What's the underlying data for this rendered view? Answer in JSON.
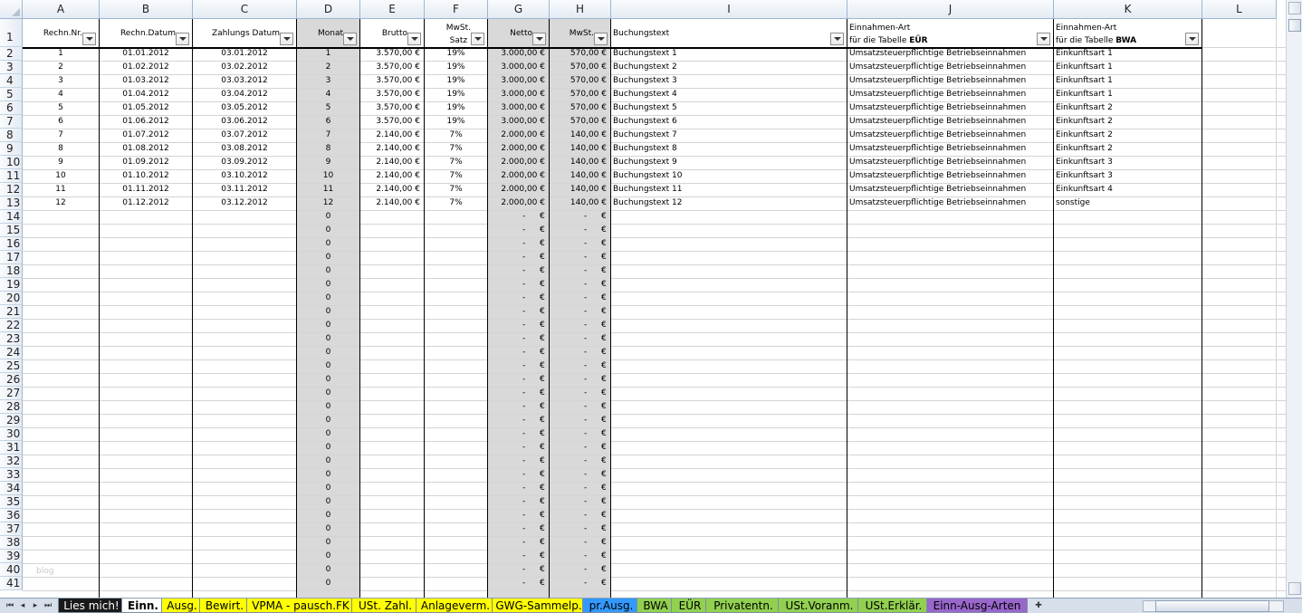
{
  "columns": [
    {
      "letter": "A",
      "w": 85
    },
    {
      "letter": "B",
      "w": 103
    },
    {
      "letter": "C",
      "w": 115
    },
    {
      "letter": "D",
      "w": 70
    },
    {
      "letter": "E",
      "w": 71
    },
    {
      "letter": "F",
      "w": 70
    },
    {
      "letter": "G",
      "w": 68
    },
    {
      "letter": "H",
      "w": 68
    },
    {
      "letter": "I",
      "w": 261
    },
    {
      "letter": "J",
      "w": 228
    },
    {
      "letter": "K",
      "w": 164
    },
    {
      "letter": "L",
      "w": 82
    }
  ],
  "headers": [
    {
      "text": "Rechn.Nr.",
      "align": "right"
    },
    {
      "text": "Rechn.Datum",
      "align": "right"
    },
    {
      "text": "Zahlungs Datum",
      "align": "right"
    },
    {
      "text": "Monat",
      "align": "right"
    },
    {
      "text": "Brutto",
      "align": "right"
    },
    {
      "line1": "MwSt.",
      "line2": "Satz",
      "align": "two"
    },
    {
      "text": "Netto",
      "align": "right"
    },
    {
      "text": "MwSt.",
      "align": "right"
    },
    {
      "text": "Buchungstext",
      "align": "left"
    },
    {
      "line1": "Einnahmen-Art",
      "line2a": "für die Tabelle ",
      "line2b": "EÜR",
      "align": "lefttwo"
    },
    {
      "line1": "Einnahmen-Art",
      "line2a": "für die Tabelle ",
      "line2b": "BWA",
      "align": "lefttwo"
    }
  ],
  "rows": [
    [
      "1",
      "01.01.2012",
      "03.01.2012",
      "1",
      "3.570,00 €",
      "19%",
      "3.000,00 €",
      "570,00 €",
      "Buchungstext 1",
      "Umsatzsteuerpflichtige Betriebseinnahmen",
      "Einkunftsart 1"
    ],
    [
      "2",
      "01.02.2012",
      "03.02.2012",
      "2",
      "3.570,00 €",
      "19%",
      "3.000,00 €",
      "570,00 €",
      "Buchungstext 2",
      "Umsatzsteuerpflichtige Betriebseinnahmen",
      "Einkunftsart 1"
    ],
    [
      "3",
      "01.03.2012",
      "03.03.2012",
      "3",
      "3.570,00 €",
      "19%",
      "3.000,00 €",
      "570,00 €",
      "Buchungstext 3",
      "Umsatzsteuerpflichtige Betriebseinnahmen",
      "Einkunftsart 1"
    ],
    [
      "4",
      "01.04.2012",
      "03.04.2012",
      "4",
      "3.570,00 €",
      "19%",
      "3.000,00 €",
      "570,00 €",
      "Buchungstext 4",
      "Umsatzsteuerpflichtige Betriebseinnahmen",
      "Einkunftsart 1"
    ],
    [
      "5",
      "01.05.2012",
      "03.05.2012",
      "5",
      "3.570,00 €",
      "19%",
      "3.000,00 €",
      "570,00 €",
      "Buchungstext 5",
      "Umsatzsteuerpflichtige Betriebseinnahmen",
      "Einkunftsart 2"
    ],
    [
      "6",
      "01.06.2012",
      "03.06.2012",
      "6",
      "3.570,00 €",
      "19%",
      "3.000,00 €",
      "570,00 €",
      "Buchungstext 6",
      "Umsatzsteuerpflichtige Betriebseinnahmen",
      "Einkunftsart 2"
    ],
    [
      "7",
      "01.07.2012",
      "03.07.2012",
      "7",
      "2.140,00 €",
      "7%",
      "2.000,00 €",
      "140,00 €",
      "Buchungstext 7",
      "Umsatzsteuerpflichtige Betriebseinnahmen",
      "Einkunftsart 2"
    ],
    [
      "8",
      "01.08.2012",
      "03.08.2012",
      "8",
      "2.140,00 €",
      "7%",
      "2.000,00 €",
      "140,00 €",
      "Buchungstext 8",
      "Umsatzsteuerpflichtige Betriebseinnahmen",
      "Einkunftsart 2"
    ],
    [
      "9",
      "01.09.2012",
      "03.09.2012",
      "9",
      "2.140,00 €",
      "7%",
      "2.000,00 €",
      "140,00 €",
      "Buchungstext 9",
      "Umsatzsteuerpflichtige Betriebseinnahmen",
      "Einkunftsart 3"
    ],
    [
      "10",
      "01.10.2012",
      "03.10.2012",
      "10",
      "2.140,00 €",
      "7%",
      "2.000,00 €",
      "140,00 €",
      "Buchungstext 10",
      "Umsatzsteuerpflichtige Betriebseinnahmen",
      "Einkunftsart 3"
    ],
    [
      "11",
      "01.11.2012",
      "03.11.2012",
      "11",
      "2.140,00 €",
      "7%",
      "2.000,00 €",
      "140,00 €",
      "Buchungstext 11",
      "Umsatzsteuerpflichtige Betriebseinnahmen",
      "Einkunftsart 4"
    ],
    [
      "12",
      "01.12.2012",
      "03.12.2012",
      "12",
      "2.140,00 €",
      "7%",
      "2.000,00 €",
      "140,00 €",
      "Buchungstext 12",
      "Umsatzsteuerpflichtige Betriebseinnahmen",
      "sonstige"
    ]
  ],
  "empty_rows": {
    "monat": "0",
    "dash": "-",
    "euro": "€"
  },
  "row_numbers": [
    "1",
    "2",
    "3",
    "4",
    "5",
    "6",
    "7",
    "8",
    "9",
    "10",
    "11",
    "12",
    "13",
    "14",
    "15",
    "16",
    "17",
    "18",
    "19",
    "20",
    "21",
    "22",
    "23",
    "24",
    "25",
    "26",
    "27",
    "28",
    "29",
    "30",
    "31",
    "32",
    "33",
    "34",
    "35",
    "36",
    "37",
    "38",
    "39",
    "40",
    "41"
  ],
  "watermark": "blog",
  "tabs": [
    {
      "label": "Lies mich!",
      "bg": "#1a1a1a",
      "color": "#ffffff",
      "w": 74
    },
    {
      "label": "Einn.",
      "bg": "#ffffff",
      "color": "#000000",
      "w": 48,
      "active": true
    },
    {
      "label": "Ausg.",
      "bg": "#ffff00",
      "color": "#000000",
      "w": 46
    },
    {
      "label": "Bewirt.",
      "bg": "#ffff00",
      "color": "#000000",
      "w": 56
    },
    {
      "label": "VPMA - pausch.FK",
      "bg": "#ffff00",
      "color": "#000000",
      "w": 120
    },
    {
      "label": "USt. Zahl.",
      "bg": "#ffff00",
      "color": "#000000",
      "w": 75
    },
    {
      "label": "Anlageverm.",
      "bg": "#ffff00",
      "color": "#000000",
      "w": 88
    },
    {
      "label": "GWG-Sammelp.",
      "bg": "#ffff00",
      "color": "#000000",
      "w": 104
    },
    {
      "label": "pr.Ausg.",
      "bg": "#3399ff",
      "color": "#000000",
      "w": 64
    },
    {
      "label": "BWA",
      "bg": "#92d050",
      "color": "#000000",
      "w": 42
    },
    {
      "label": "EÜR",
      "bg": "#92d050",
      "color": "#000000",
      "w": 42
    },
    {
      "label": "Privatentn.",
      "bg": "#92d050",
      "color": "#000000",
      "w": 84
    },
    {
      "label": "USt.Voranm.",
      "bg": "#92d050",
      "color": "#000000",
      "w": 92
    },
    {
      "label": "USt.Erklär.",
      "bg": "#92d050",
      "color": "#000000",
      "w": 80
    },
    {
      "label": "Einn-Ausg-Arten",
      "bg": "#9966cc",
      "color": "#000000",
      "w": 112
    }
  ],
  "nav": {
    "first": "⏮",
    "prev": "◂",
    "next": "▸",
    "last": "⏭",
    "new_sheet": "✚"
  }
}
